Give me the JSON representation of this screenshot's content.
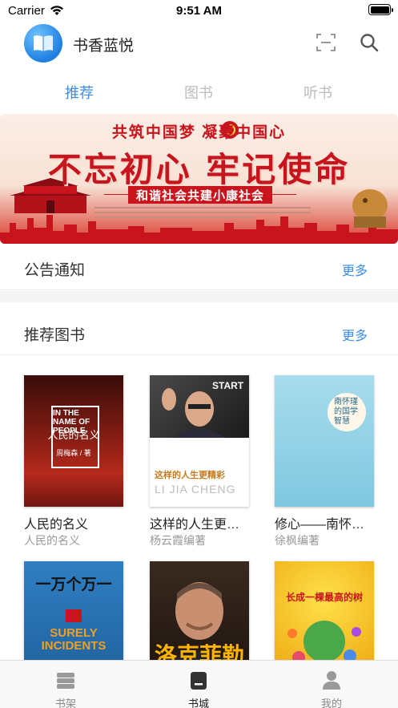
{
  "status_bar": {
    "carrier": "Carrier",
    "time": "9:51 AM"
  },
  "header": {
    "app_title": "书香蓝悦",
    "logo_icon": "book-logo-icon",
    "scan_icon": "scan-icon",
    "search_icon": "search-icon"
  },
  "tabs": [
    {
      "label": "推荐",
      "active": true
    },
    {
      "label": "图书",
      "active": false
    },
    {
      "label": "听书",
      "active": false
    }
  ],
  "banner": {
    "subtitle": "共筑中国梦 凝聚中国心",
    "headline": "不忘初心 牢记使命",
    "ribbon": "和谐社会共建小康社会"
  },
  "sections": {
    "notice": {
      "title": "公告通知",
      "more": "更多"
    },
    "recommend": {
      "title": "推荐图书",
      "more": "更多"
    }
  },
  "books": [
    {
      "title": "人民的名义",
      "author": "人民的名义",
      "cover_title": "人民的名义",
      "cover_en": "IN THE NAME OF PEOPLE",
      "cover_author": "周梅森 / 著"
    },
    {
      "title": "这样的人生更…",
      "author": "杨云霞编著",
      "cover_title": "这样的人生更精彩",
      "cover_en": "START",
      "cover_sub": "LI JIA CHENG"
    },
    {
      "title": "修心——南怀…",
      "author": "徐枫编著",
      "cover_title": "南怀瑾的国学智慧"
    },
    {
      "title": "",
      "author": "",
      "cover_title": "一万个万一",
      "cover_en": "SURELY INCIDENTS"
    },
    {
      "title": "",
      "author": "",
      "cover_title": "洛克菲勒"
    },
    {
      "title": "",
      "author": "",
      "cover_title": "长成一棵最高的树"
    }
  ],
  "tab_bar": [
    {
      "label": "书架",
      "icon": "bookshelf-icon",
      "active": false
    },
    {
      "label": "书城",
      "icon": "bookstore-icon",
      "active": true
    },
    {
      "label": "我的",
      "icon": "profile-icon",
      "active": false
    }
  ],
  "colors": {
    "accent": "#3a8ee6",
    "banner_red": "#c8141c"
  }
}
